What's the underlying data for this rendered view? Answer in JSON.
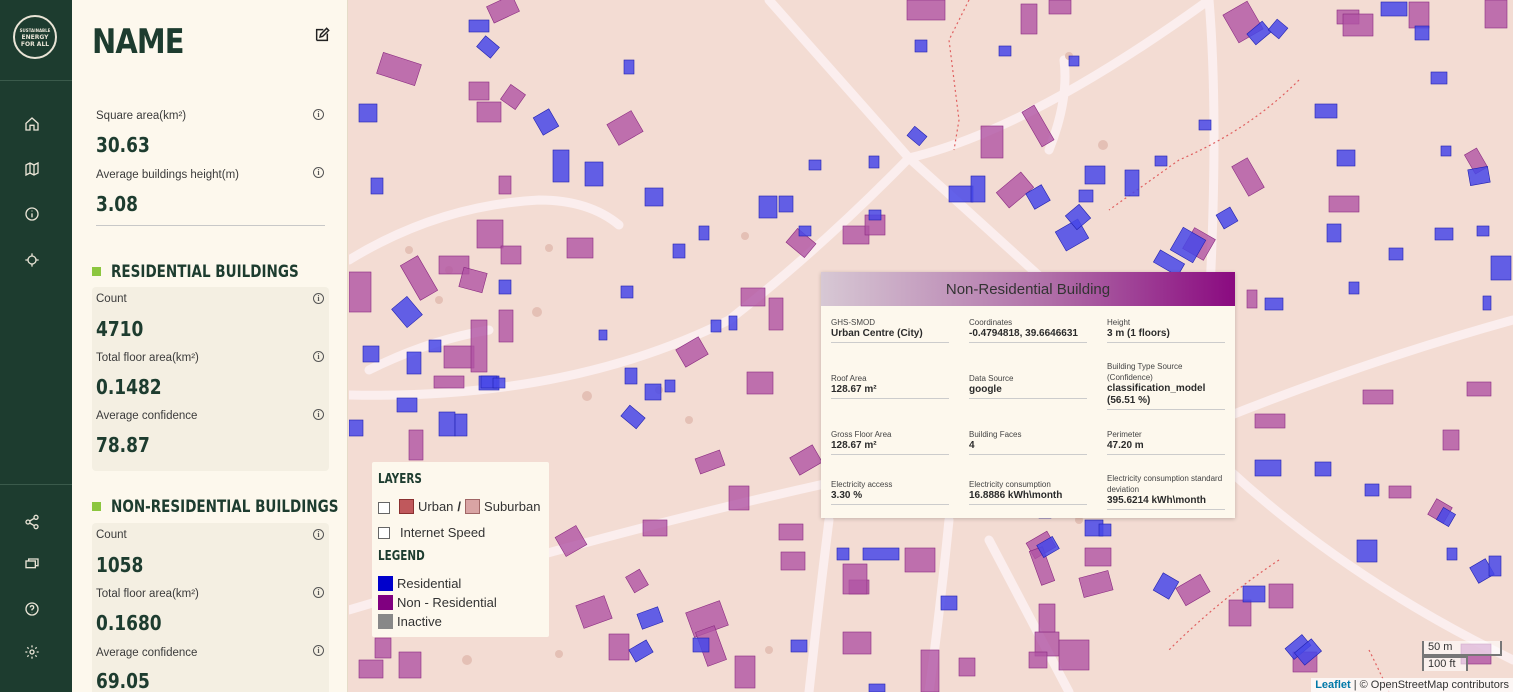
{
  "nav": {
    "logo_lines": [
      "SUSTAINABLE",
      "ENERGY",
      "FOR ALL"
    ],
    "top_icons": [
      "home-icon",
      "map-icon",
      "info-icon",
      "crosshair-icon"
    ],
    "bottom_icons": [
      "share-icon",
      "chat-icon",
      "help-icon",
      "settings-icon"
    ]
  },
  "panel": {
    "title": "NAME",
    "square_area_label": "Square area(km²)",
    "square_area_value": "30.63",
    "avg_height_label": "Average buildings height(m)",
    "avg_height_value": "3.08",
    "residential": {
      "heading": "RESIDENTIAL BUILDINGS",
      "count_label": "Count",
      "count_value": "4710",
      "floor_label": "Total floor area(km²)",
      "floor_value": "0.1482",
      "conf_label": "Average confidence",
      "conf_value": "78.87"
    },
    "non_residential": {
      "heading": "NON-RESIDENTIAL BUILDINGS",
      "count_label": "Count",
      "count_value": "1058",
      "floor_label": "Total floor area(km²)",
      "floor_value": "0.1680",
      "conf_label": "Average confidence",
      "conf_value": "69.05"
    }
  },
  "popup": {
    "title": "Non-Residential Building",
    "fields": [
      {
        "label": "GHS-SMOD",
        "value": "Urban Centre (City)"
      },
      {
        "label": "Coordinates",
        "value": "-0.4794818, 39.6646631"
      },
      {
        "label": "Height",
        "value": "3 m (1 floors)"
      },
      {
        "label": "Roof Area",
        "value": "128.67 m²"
      },
      {
        "label": "Data Source",
        "value": "google"
      },
      {
        "label": "Building Type Source (Confidence)",
        "value": "classification_model (56.51 %)"
      },
      {
        "label": "Gross Floor Area",
        "value": "128.67 m²"
      },
      {
        "label": "Building Faces",
        "value": "4"
      },
      {
        "label": "Perimeter",
        "value": "47.20 m"
      },
      {
        "label": "Electricity access",
        "value": "3.30 %"
      },
      {
        "label": "Electricity consumption",
        "value": "16.8886 kWh\\month"
      },
      {
        "label": "Electricity consumption standard deviation",
        "value": "395.6214 kWh\\month"
      }
    ]
  },
  "layers": {
    "layers_heading": "LAYERS",
    "urban_label": "Urban",
    "slash": "/",
    "suburban_label": "Suburban",
    "internet_label": "Internet Speed",
    "legend_heading": "LEGEND",
    "residential_label": "Residential",
    "nonres_label": "Non - Residential",
    "inactive_label": "Inactive",
    "colors": {
      "urban": "#c0585c",
      "suburban": "#d9a4a4",
      "residential": "#0000cc",
      "nonres": "#800080",
      "inactive": "#888888"
    }
  },
  "scale": {
    "metric": "50 m",
    "imperial": "100 ft"
  },
  "attribution": {
    "leaflet": "Leaflet",
    "osm": "| © OpenStreetMap contributors"
  }
}
